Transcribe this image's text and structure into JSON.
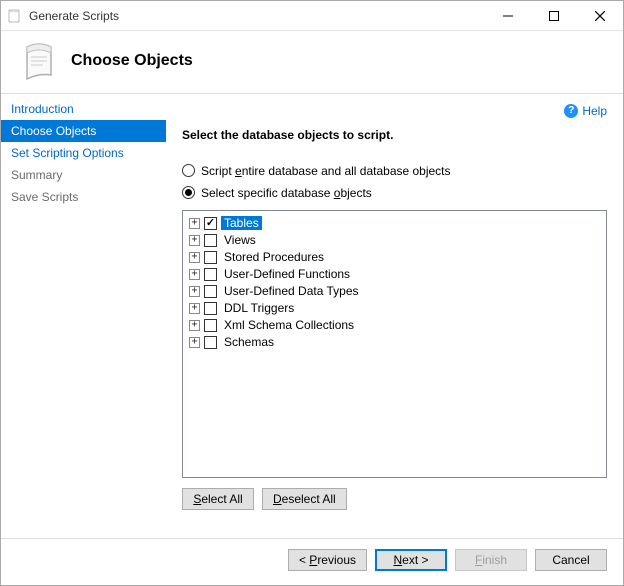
{
  "window": {
    "title": "Generate Scripts"
  },
  "header": {
    "title": "Choose Objects"
  },
  "help": {
    "label": "Help"
  },
  "sidebar": {
    "items": [
      {
        "label": "Introduction",
        "state": "normal"
      },
      {
        "label": "Choose Objects",
        "state": "selected"
      },
      {
        "label": "Set Scripting Options",
        "state": "normal"
      },
      {
        "label": "Summary",
        "state": "disabled"
      },
      {
        "label": "Save Scripts",
        "state": "disabled"
      }
    ]
  },
  "content": {
    "instruction": "Select the database objects to script.",
    "radios": {
      "entire": {
        "text": "Script entire database and all database objects",
        "hotkey": "e",
        "checked": false
      },
      "specific": {
        "text": "Select specific database objects",
        "hotkey": "o",
        "checked": true
      }
    },
    "tree": [
      {
        "label": "Tables",
        "checked": true,
        "selected": true
      },
      {
        "label": "Views",
        "checked": false,
        "selected": false
      },
      {
        "label": "Stored Procedures",
        "checked": false,
        "selected": false
      },
      {
        "label": "User-Defined Functions",
        "checked": false,
        "selected": false
      },
      {
        "label": "User-Defined Data Types",
        "checked": false,
        "selected": false
      },
      {
        "label": "DDL Triggers",
        "checked": false,
        "selected": false
      },
      {
        "label": "Xml Schema Collections",
        "checked": false,
        "selected": false
      },
      {
        "label": "Schemas",
        "checked": false,
        "selected": false
      }
    ],
    "buttons": {
      "select_all": {
        "text": "Select All",
        "hotkey": "S"
      },
      "deselect_all": {
        "text": "Deselect All",
        "hotkey": "D"
      }
    }
  },
  "footer": {
    "previous": {
      "text": "< Previous",
      "hotkey": "P",
      "enabled": true
    },
    "next": {
      "text": "Next >",
      "hotkey": "N",
      "enabled": true,
      "default": true
    },
    "finish": {
      "text": "Finish",
      "hotkey": "F",
      "enabled": false
    },
    "cancel": {
      "text": "Cancel",
      "enabled": true
    }
  }
}
